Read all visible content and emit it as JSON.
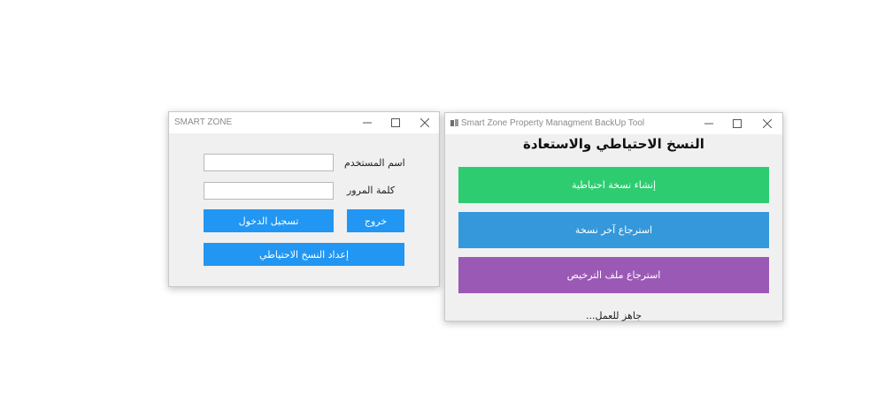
{
  "login_window": {
    "title": "SMART ZONE",
    "username_label": "اسم المستخدم",
    "username_value": "",
    "password_label": "كلمة المرور",
    "password_value": "",
    "login_button": "تسجيل الدخول",
    "exit_button": "خروج",
    "backup_setup_button": "إعداد النسخ الاحتياطي"
  },
  "backup_window": {
    "title": "Smart Zone  Property Managment BackUp Tool",
    "heading": "النسخ الاحتياطي والاستعادة",
    "create_backup_button": "إنشاء نسخة احتياطية",
    "restore_last_button": "استرجاع آخر نسخة",
    "restore_license_button": "استرجاع ملف الترخيص",
    "status": "جاهز للعمل..."
  },
  "colors": {
    "accent_blue": "#2196f3",
    "green": "#2ecc71",
    "blue": "#3498db",
    "purple": "#9b59b6"
  },
  "icons": [
    "minimize-icon",
    "maximize-icon",
    "close-icon",
    "app-icon"
  ]
}
